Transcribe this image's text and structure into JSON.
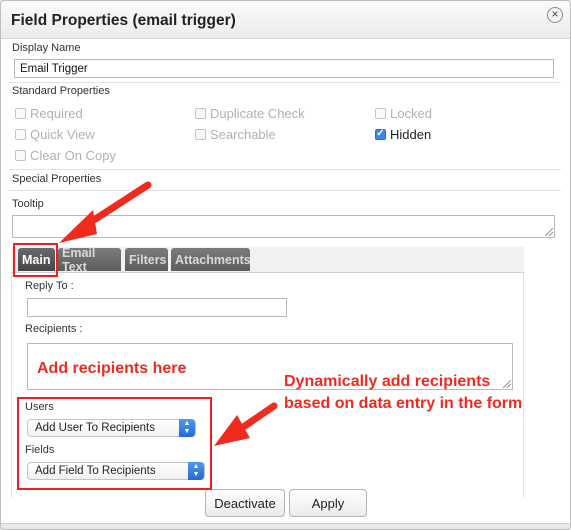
{
  "window": {
    "title": "Field Properties (email trigger)"
  },
  "display_name": {
    "label": "Display Name",
    "value": "Email Trigger"
  },
  "standard_properties": {
    "label": "Standard Properties",
    "checkboxes": [
      {
        "label": "Required",
        "checked": false
      },
      {
        "label": "Quick View",
        "checked": false
      },
      {
        "label": "Clear On Copy",
        "checked": false
      },
      {
        "label": "Duplicate Check",
        "checked": false
      },
      {
        "label": "Searchable",
        "checked": false
      },
      {
        "label": "Locked",
        "checked": false
      },
      {
        "label": "Hidden",
        "checked": true
      }
    ]
  },
  "special_properties": {
    "label": "Special Properties"
  },
  "tooltip": {
    "label": "Tooltip",
    "value": ""
  },
  "tabs": [
    {
      "label": "Main",
      "active": true
    },
    {
      "label": "Email Text",
      "active": false
    },
    {
      "label": "Filters",
      "active": false
    },
    {
      "label": "Attachments",
      "active": false
    }
  ],
  "main_tab": {
    "reply_to": {
      "label": "Reply To :",
      "value": ""
    },
    "recipients": {
      "label": "Recipients :",
      "value": ""
    },
    "users": {
      "label": "Users",
      "selected": "Add User To Recipients"
    },
    "fields": {
      "label": "Fields",
      "selected": "Add Field To Recipients"
    }
  },
  "buttons": {
    "deactivate": "Deactivate",
    "apply": "Apply"
  },
  "annotations": {
    "add_recipients": "Add recipients here",
    "dynamic_line1": "Dynamically add recipients",
    "dynamic_line2": "based on data entry in the form",
    "color": "#ef1f1f"
  },
  "icons": {
    "close": "close-icon",
    "select_arrow": "updown-chevron-icon",
    "resize": "resize-grip-icon"
  },
  "colors": {
    "accent": "#3d86e8",
    "tab_active": "#454545",
    "tab_inactive": "#6d6d6d"
  }
}
